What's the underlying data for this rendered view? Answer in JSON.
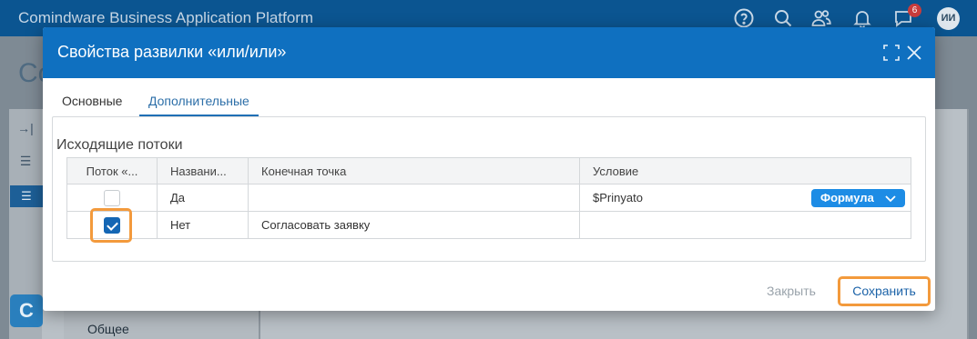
{
  "app": {
    "title": "Comindware Business Application Platform",
    "notification_count": "6",
    "user_initials": "ИИ"
  },
  "background": {
    "heading_fragment": "Co",
    "logo_letter": "C",
    "nav_label": "Общее"
  },
  "dialog": {
    "title": "Свойства развилки «или/или»",
    "tabs": [
      {
        "label": "Основные",
        "active": false
      },
      {
        "label": "Дополнительные",
        "active": true
      }
    ],
    "section_title": "Исходящие потоки",
    "columns": [
      "Поток «...",
      "Названи...",
      "Конечная точка",
      "Условие"
    ],
    "rows": [
      {
        "checked": false,
        "name": "Да",
        "endpoint": "",
        "condition": "$Prinyato",
        "condition_type": "Формула"
      },
      {
        "checked": true,
        "name": "Нет",
        "endpoint": "Согласовать заявку",
        "condition": "",
        "condition_type": ""
      }
    ],
    "close_label": "Закрыть",
    "save_label": "Сохранить"
  },
  "colors": {
    "header_blue": "#0f70c0",
    "topbar_blue": "#0b5591",
    "highlight_orange": "#f39a3c",
    "formula_blue": "#1d8ce5"
  }
}
